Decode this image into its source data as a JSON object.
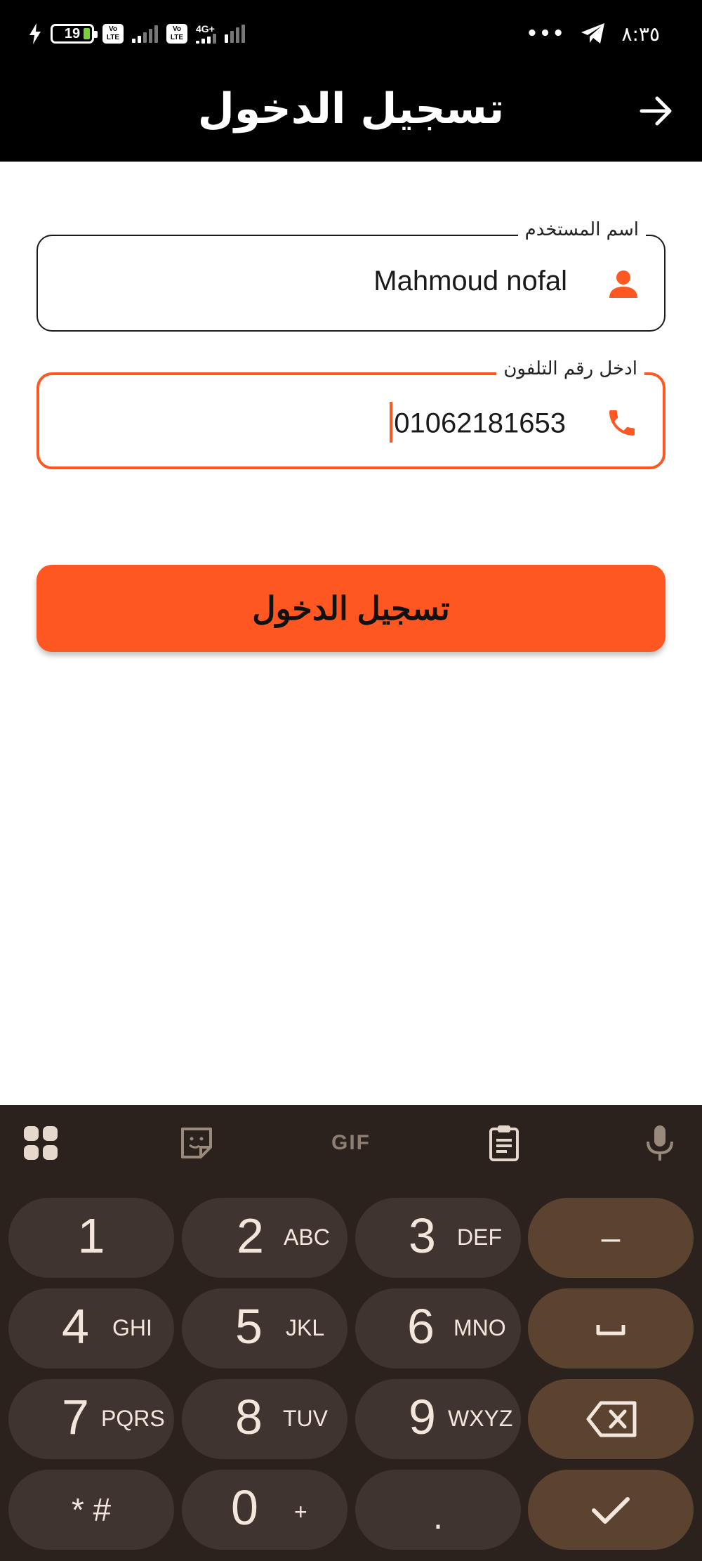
{
  "status_bar": {
    "battery": "19",
    "volte": "Vo LTE",
    "network": "4G+",
    "more": "•••",
    "time": "٨:٣٥"
  },
  "app_bar": {
    "title": "تسجيل الدخول"
  },
  "form": {
    "username": {
      "label": "اسم المستخدم",
      "value": "Mahmoud nofal"
    },
    "phone": {
      "label": "ادخل رقم التلفون",
      "value": "01062181653"
    },
    "login_button": "تسجيل الدخول"
  },
  "keyboard": {
    "toolbar": {
      "gif": "GIF"
    },
    "keys": {
      "k1": {
        "num": "1",
        "sub": ""
      },
      "k2": {
        "num": "2",
        "sub": "ABC"
      },
      "k3": {
        "num": "3",
        "sub": "DEF"
      },
      "k4": {
        "num": "4",
        "sub": "GHI"
      },
      "k5": {
        "num": "5",
        "sub": "JKL"
      },
      "k6": {
        "num": "6",
        "sub": "MNO"
      },
      "k7": {
        "num": "7",
        "sub": "PQRS"
      },
      "k8": {
        "num": "8",
        "sub": "TUV"
      },
      "k9": {
        "num": "9",
        "sub": "WXYZ"
      },
      "k0": {
        "num": "0",
        "sub": "+"
      },
      "star_hash": "* #",
      "dot": ".",
      "dash": "–"
    }
  }
}
